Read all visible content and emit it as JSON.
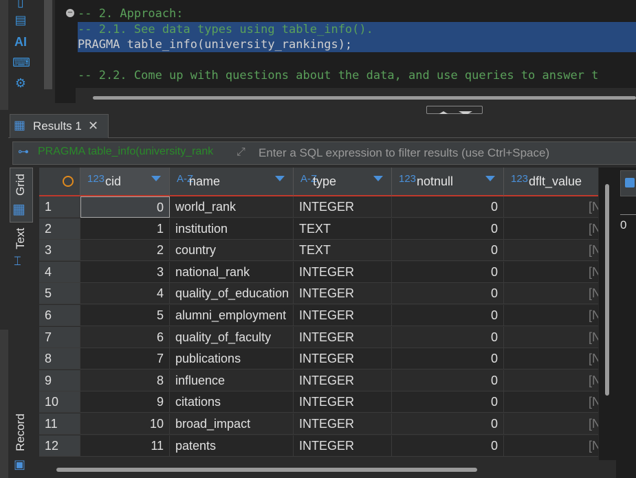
{
  "editor": {
    "lines": [
      {
        "text": "-- 2. Approach:",
        "class": "comment"
      },
      {
        "text": "-- 2.1. See data types using table_info().",
        "class": "comment sel"
      },
      {
        "text": "PRAGMA table_info(university_rankings);",
        "class": "kw sel"
      },
      {
        "text": "",
        "class": ""
      },
      {
        "text": "-- 2.2. Come up with questions about the data, and use queries to answer t",
        "class": "comment"
      }
    ]
  },
  "toolbar": {
    "icons": [
      "document-icon",
      "script-icon",
      "ai-icon",
      "terminal-icon",
      "settings-icon"
    ],
    "ai_label": "AI",
    "more_label": "...."
  },
  "results_tab": {
    "label": "Results 1",
    "close": "✕"
  },
  "filter": {
    "query": "PRAGMA table_info(university_rank",
    "placeholder": "Enter a SQL expression to filter results (use Ctrl+Space)"
  },
  "vtabs": {
    "grid": "Grid",
    "text": "Text",
    "record": "Record"
  },
  "columns": [
    {
      "type": "123",
      "name": "cid"
    },
    {
      "type": "A-Z",
      "name": "name"
    },
    {
      "type": "A-Z",
      "name": "type"
    },
    {
      "type": "123",
      "name": "notnull"
    },
    {
      "type": "123",
      "name": "dflt_value"
    }
  ],
  "rows": [
    {
      "n": "1",
      "cid": "0",
      "name": "world_rank",
      "type": "INTEGER",
      "notnull": "0",
      "dflt": "[N"
    },
    {
      "n": "2",
      "cid": "1",
      "name": "institution",
      "type": "TEXT",
      "notnull": "0",
      "dflt": "[N"
    },
    {
      "n": "3",
      "cid": "2",
      "name": "country",
      "type": "TEXT",
      "notnull": "0",
      "dflt": "[N"
    },
    {
      "n": "4",
      "cid": "3",
      "name": "national_rank",
      "type": "INTEGER",
      "notnull": "0",
      "dflt": "[N"
    },
    {
      "n": "5",
      "cid": "4",
      "name": "quality_of_education",
      "type": "INTEGER",
      "notnull": "0",
      "dflt": "[N"
    },
    {
      "n": "6",
      "cid": "5",
      "name": "alumni_employment",
      "type": "INTEGER",
      "notnull": "0",
      "dflt": "[N"
    },
    {
      "n": "7",
      "cid": "6",
      "name": "quality_of_faculty",
      "type": "INTEGER",
      "notnull": "0",
      "dflt": "[N"
    },
    {
      "n": "8",
      "cid": "7",
      "name": "publications",
      "type": "INTEGER",
      "notnull": "0",
      "dflt": "[N"
    },
    {
      "n": "9",
      "cid": "8",
      "name": "influence",
      "type": "INTEGER",
      "notnull": "0",
      "dflt": "[N"
    },
    {
      "n": "10",
      "cid": "9",
      "name": "citations",
      "type": "INTEGER",
      "notnull": "0",
      "dflt": "[N"
    },
    {
      "n": "11",
      "cid": "10",
      "name": "broad_impact",
      "type": "INTEGER",
      "notnull": "0",
      "dflt": "[N"
    },
    {
      "n": "12",
      "cid": "11",
      "name": "patents",
      "type": "INTEGER",
      "notnull": "0",
      "dflt": "[N"
    }
  ],
  "right_panel": {
    "value": "0"
  }
}
